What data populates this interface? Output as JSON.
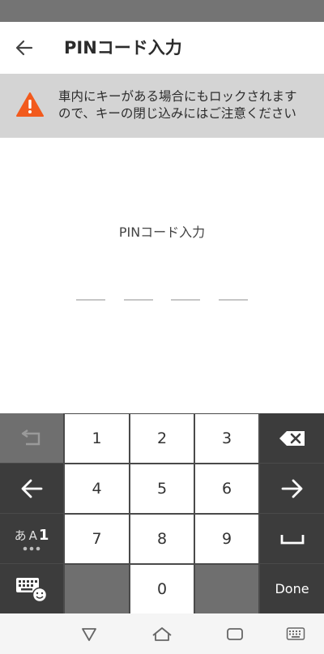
{
  "app_bar": {
    "title": "PINコード入力",
    "back_icon": "arrow-left-icon"
  },
  "warning": {
    "icon": "warning-triangle-icon",
    "color": "#f25a1d",
    "line1": "車内にキーがある場合にもロックされます",
    "line2": "ので、キーの閉じ込みにはご注意ください"
  },
  "pin": {
    "label": "PINコード入力",
    "digits_entered": 0,
    "length": 4
  },
  "keyboard": {
    "keys": {
      "k1": "1",
      "k2": "2",
      "k3": "3",
      "k4": "4",
      "k5": "5",
      "k6": "6",
      "k7": "7",
      "k8": "8",
      "k9": "9",
      "k0": "0"
    },
    "done_label": "Done",
    "mode_label_kana": "あ",
    "mode_label_alpha": "A",
    "mode_label_num": "1"
  },
  "nav_bar": {
    "icons": [
      "back-triangle-icon",
      "home-icon",
      "recents-icon",
      "keyboard-icon"
    ]
  }
}
